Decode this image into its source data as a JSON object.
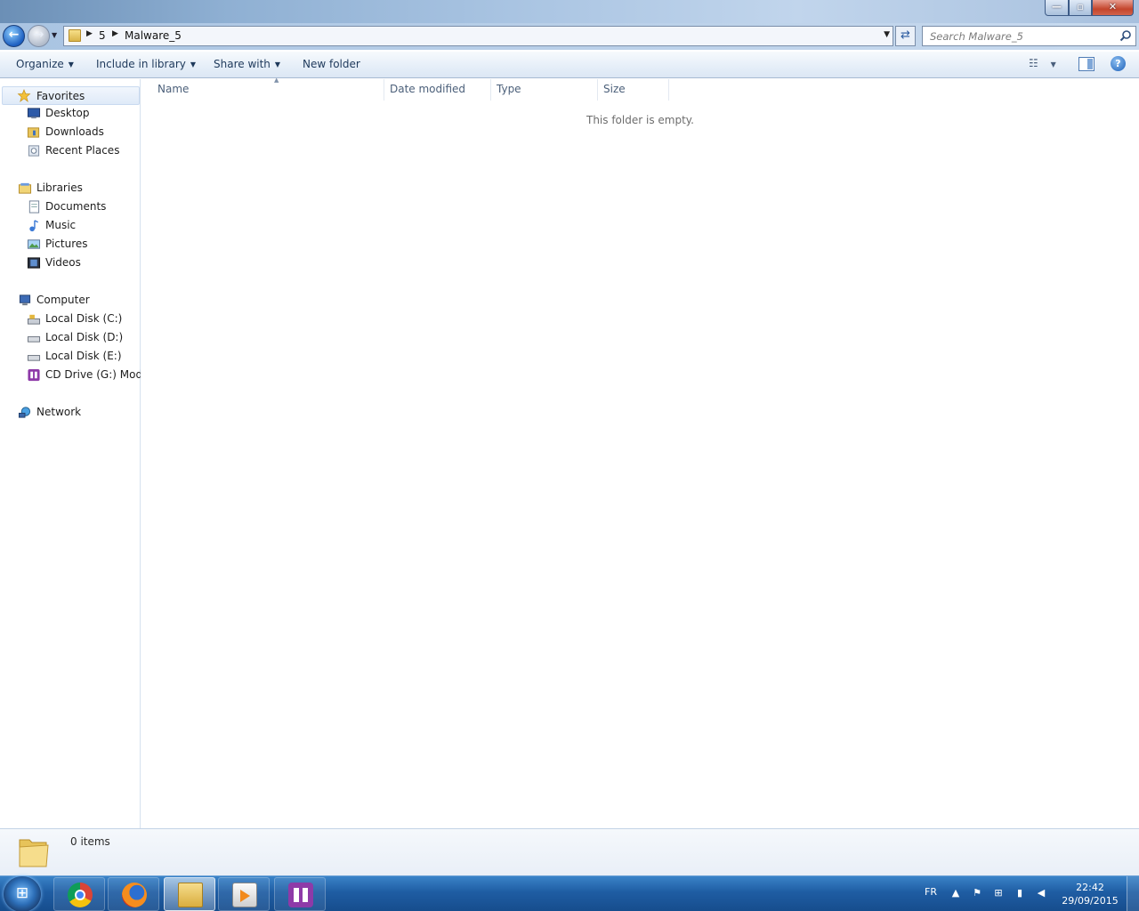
{
  "window": {
    "controls": {
      "minimize": "—",
      "maximize": "▫",
      "close": "✕"
    }
  },
  "address": {
    "crumbs": [
      "5",
      "Malware_5"
    ],
    "search_placeholder": "Search Malware_5"
  },
  "toolbar": {
    "organize": "Organize",
    "include_in_library": "Include in library",
    "share_with": "Share with",
    "new_folder": "New folder"
  },
  "navpane": {
    "favorites": {
      "label": "Favorites",
      "items": [
        "Desktop",
        "Downloads",
        "Recent Places"
      ]
    },
    "libraries": {
      "label": "Libraries",
      "items": [
        "Documents",
        "Music",
        "Pictures",
        "Videos"
      ]
    },
    "computer": {
      "label": "Computer",
      "items": [
        "Local Disk (C:)",
        "Local Disk (D:)",
        "Local Disk (E:)",
        "CD Drive (G:) Moder"
      ]
    },
    "network": {
      "label": "Network"
    }
  },
  "content": {
    "columns": [
      "Name",
      "Date modified",
      "Type",
      "Size"
    ],
    "empty_message": "This folder is empty."
  },
  "details": {
    "item_count": "0 items"
  },
  "taskbar": {
    "apps": [
      "chrome-icon",
      "firefox-icon",
      "explorer-icon",
      "media-player-icon",
      "cd-drive-app-icon"
    ],
    "language": "FR",
    "time": "22:42",
    "date": "29/09/2015"
  },
  "colors": {
    "accent": "#1e395b",
    "taskbar": "#1f5da3"
  }
}
